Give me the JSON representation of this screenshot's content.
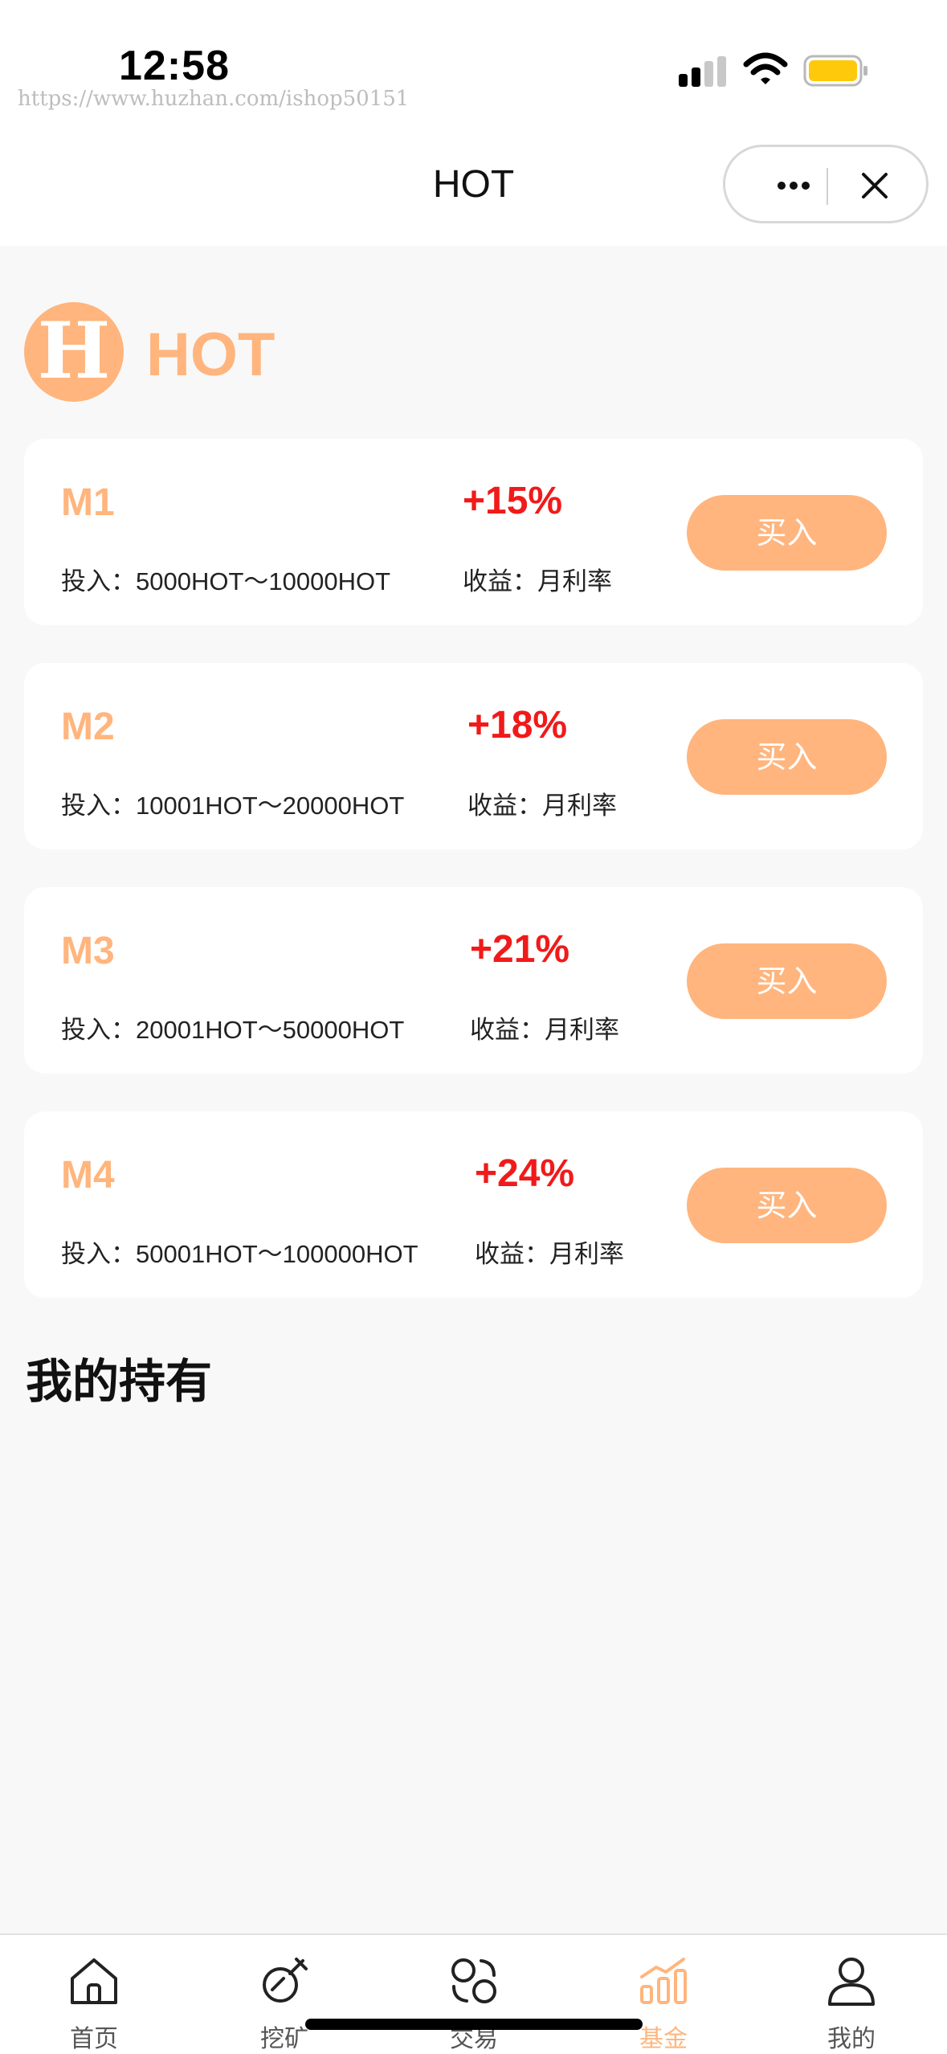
{
  "status_bar": {
    "time": "12:58",
    "watermark": "https://www.huzhan.com/ishop50151",
    "icons": [
      "signal-icon",
      "wifi-icon",
      "battery-icon"
    ]
  },
  "nav": {
    "title": "HOT",
    "more_icon": "more-dots-icon",
    "close_icon": "close-icon"
  },
  "brand": {
    "logo_letter": "H",
    "name": "HOT"
  },
  "funds": [
    {
      "plan": "M1",
      "invest": "投入：5000HOT～10000HOT",
      "rate": "+15%",
      "yield": "收益：月利率",
      "buy_label": "买入"
    },
    {
      "plan": "M2",
      "invest": "投入：10001HOT～20000HOT",
      "rate": "+18%",
      "yield": "收益：月利率",
      "buy_label": "买入"
    },
    {
      "plan": "M3",
      "invest": "投入：20001HOT～50000HOT",
      "rate": "+21%",
      "yield": "收益：月利率",
      "buy_label": "买入"
    },
    {
      "plan": "M4",
      "invest": "投入：50001HOT～100000HOT",
      "rate": "+24%",
      "yield": "收益：月利率",
      "buy_label": "买入"
    }
  ],
  "holdings": {
    "title": "我的持有"
  },
  "tabbar": {
    "active": 3,
    "items": [
      {
        "label": "首页",
        "icon": "home-icon"
      },
      {
        "label": "挖矿",
        "icon": "mining-icon"
      },
      {
        "label": "交易",
        "icon": "exchange-icon"
      },
      {
        "label": "基金",
        "icon": "fund-chart-icon"
      },
      {
        "label": "我的",
        "icon": "user-icon"
      }
    ]
  },
  "colors": {
    "accent": "#ffb57d",
    "rate_red": "#f11a1a",
    "background": "#f8f8f8",
    "card": "#ffffff"
  }
}
